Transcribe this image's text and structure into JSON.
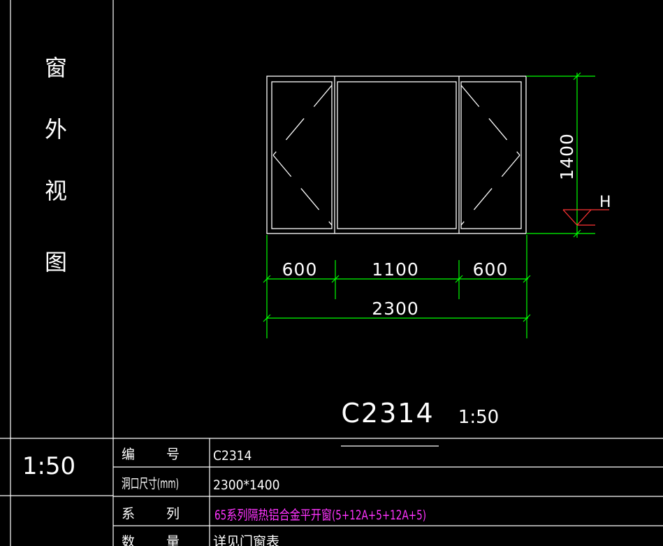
{
  "side_title_chars": [
    "窗",
    "外",
    "视",
    "图"
  ],
  "side_scale": "1:50",
  "window": {
    "dims": {
      "left": "600",
      "middle": "1100",
      "right": "600",
      "total": "2300",
      "height": "1400"
    },
    "elevation_marker": "H",
    "code": "C2314",
    "scale": "1:50"
  },
  "table": {
    "rows": [
      {
        "label_a": "编",
        "label_b": "号",
        "value": "C2314"
      },
      {
        "label": "洞口尺寸(mm)",
        "value": "2300*1400"
      },
      {
        "label_a": "系",
        "label_b": "列",
        "value": "65系列隔热铝合金平开窗(5+12A+5+12A+5)"
      },
      {
        "label_a": "数",
        "label_b": "量",
        "value": "详见门窗表"
      }
    ]
  },
  "colors": {
    "lines": "#ffffff",
    "dimension": "#00ff00",
    "series_text": "#ff33ff"
  }
}
